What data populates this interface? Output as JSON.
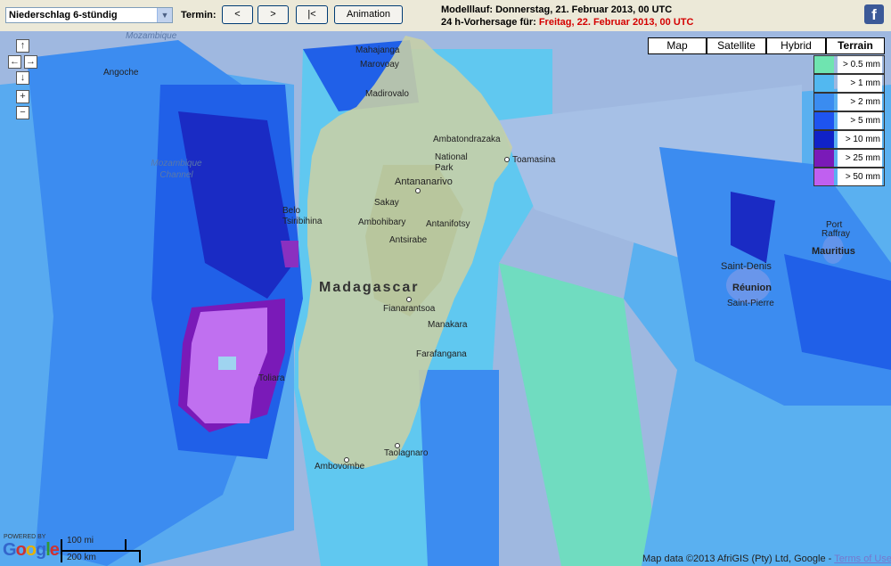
{
  "toolbar": {
    "product": "Niederschlag 6-stündig",
    "termin_label": "Termin:",
    "prev_label": "<",
    "next_label": ">",
    "first_label": "|<",
    "animation_label": "Animation",
    "modelrun_label": "Modelllauf: Donnerstag, 21. Februar 2013, 00 UTC",
    "forecast_prefix": "24 h-Vorhersage für: ",
    "forecast_date": "Freitag, 22. Februar 2013, 00 UTC",
    "facebook": "f"
  },
  "nav": {
    "up": "↑",
    "left": "←",
    "right": "→",
    "down": "↓",
    "zoom_in": "+",
    "zoom_out": "−"
  },
  "map_types": [
    "Map",
    "Satellite",
    "Hybrid",
    "Terrain"
  ],
  "active_map_type": "Terrain",
  "legend": [
    {
      "label": "> 0.5 mm",
      "color": "#6fe4b0"
    },
    {
      "label": "> 1 mm",
      "color": "#52b8f0"
    },
    {
      "label": "> 2 mm",
      "color": "#3a8cf0"
    },
    {
      "label": "> 5 mm",
      "color": "#1e54f0"
    },
    {
      "label": "> 10 mm",
      "color": "#1022c8"
    },
    {
      "label": "> 25 mm",
      "color": "#7a1ab8"
    },
    {
      "label": "> 50 mm",
      "color": "#c060f0"
    }
  ],
  "places": {
    "mozambique": "Mozambique",
    "mahajanga": "Mahajanga",
    "marovoay": "Marovoay",
    "madirovalo": "Madirovalo",
    "angoche": "Angoche",
    "ambatondrazaka": "Ambatondrazaka",
    "national_park": "National Park",
    "toamasina": "Toamasina",
    "mozambique_channel": "Mozambique Channel",
    "antananarivo": "Antananarivo",
    "sakay": "Sakay",
    "belo": "Belo Tsiribihina",
    "ambohibary": "Ambohibary",
    "antanifotsy": "Antanifotsy",
    "antsirabe": "Antsirabe",
    "madagascar": "Madagascar",
    "fianarantsoa": "Fianarantsoa",
    "manakara": "Manakara",
    "farafangana": "Farafangana",
    "toliara": "Toliara",
    "taolagnaro": "Taolagnaro",
    "ambovombe": "Ambovombe",
    "saint_denis": "Saint-Denis",
    "reunion": "Réunion",
    "saint_pierre": "Saint-Pierre",
    "port": "Port",
    "raffray": "Raffray",
    "mauritius": "Mauritius"
  },
  "footer": {
    "powered_by": "POWERED BY",
    "google": "Google",
    "scale_mi": "100 mi",
    "scale_km": "200 km",
    "copyright": "Map data ©2013 AfriGIS (Pty) Ltd, Google - ",
    "terms": "Terms of Use"
  }
}
